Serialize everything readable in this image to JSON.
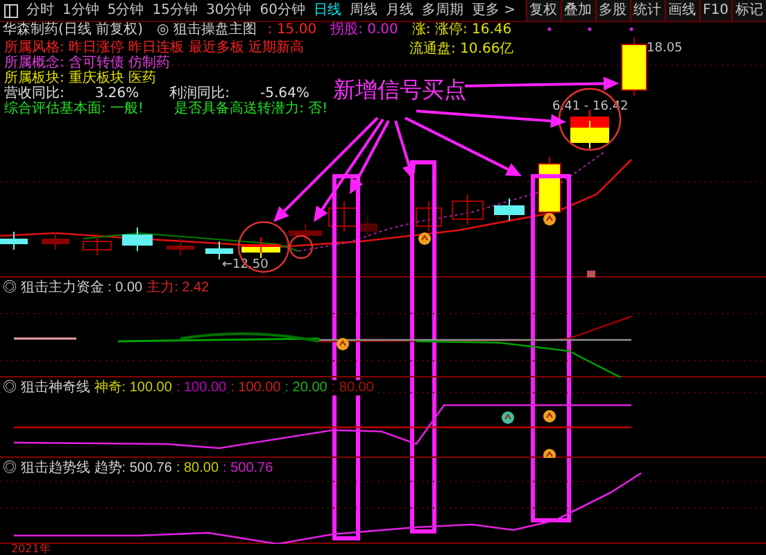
{
  "toolbar": {
    "tabs": [
      {
        "label": "分时",
        "selected": false
      },
      {
        "label": "1分钟",
        "selected": false
      },
      {
        "label": "5分钟",
        "selected": false
      },
      {
        "label": "15分钟",
        "selected": false
      },
      {
        "label": "30分钟",
        "selected": false
      },
      {
        "label": "60分钟",
        "selected": false
      },
      {
        "label": "日线",
        "selected": true
      },
      {
        "label": "周线",
        "selected": false
      },
      {
        "label": "月线",
        "selected": false
      },
      {
        "label": "多周期",
        "selected": false
      },
      {
        "label": "更多 >",
        "selected": false
      }
    ],
    "buttons": [
      "复权",
      "叠加",
      "多股",
      "统计",
      "画线",
      "F10",
      "标记"
    ]
  },
  "main_chart": {
    "title": "华森制药(日线 前复权)",
    "indicator": "◎ 狙击操盘主图",
    "readings": [
      {
        "text": ": 15.00",
        "color": "#ff2020"
      },
      {
        "text": "拐股: 0.00",
        "color": "#e020e0"
      },
      {
        "text": "涨: 涨停: 16.46",
        "color": "#e0e000"
      }
    ],
    "info_lines": [
      {
        "color": "#ff2020",
        "texts": [
          "所属风格: 昨日涨停 昨日连板 最近多板 近期新高"
        ]
      },
      {
        "color": "#e040e0",
        "texts": [
          "所属概念: 含可转债 仿制药"
        ]
      },
      {
        "color": "#e0e000",
        "texts": [
          "所属板块: 重庆板块 医药"
        ]
      },
      {
        "color": "#e0e0e0",
        "texts": [
          "营收同比:",
          "3.26%",
          "利润同比:",
          "-5.64%"
        ]
      },
      {
        "color": "#20e020",
        "texts": [
          "综合评估基本面: 一般!",
          "是否具备高送转潜力: 否!"
        ]
      }
    ],
    "float_shares": "流通盘: 10.66亿",
    "price_labels": [
      "←12.50",
      "18.05",
      "6.41 - 16.42"
    ]
  },
  "annotation": "新增信号买点",
  "panels": [
    {
      "readings": [
        {
          "text": "◎ 狙击主力资金 : 0.00",
          "color": "#d0d0d0"
        },
        {
          "text": "主力: 2.42",
          "color": "#e02020"
        }
      ]
    },
    {
      "readings": [
        {
          "text": "◎ 狙击神奇线",
          "color": "#d0d0d0"
        },
        {
          "text": "神奇: 100.00",
          "color": "#d0d000"
        },
        {
          "text": ": 100.00",
          "color": "#c000c0"
        },
        {
          "text": ": 100.00",
          "color": "#d02020"
        },
        {
          "text": ": 20.00",
          "color": "#20b020"
        },
        {
          "text": ": 80.00",
          "color": "#b01010"
        }
      ]
    },
    {
      "readings": [
        {
          "text": "◎ 狙击趋势线",
          "color": "#d0d0d0"
        },
        {
          "text": "趋势: 500.76",
          "color": "#d0d0d0"
        },
        {
          "text": ": 80.00",
          "color": "#d0d000"
        },
        {
          "text": ": 500.76",
          "color": "#d020d0"
        }
      ]
    }
  ],
  "axis_label": "2021年"
}
